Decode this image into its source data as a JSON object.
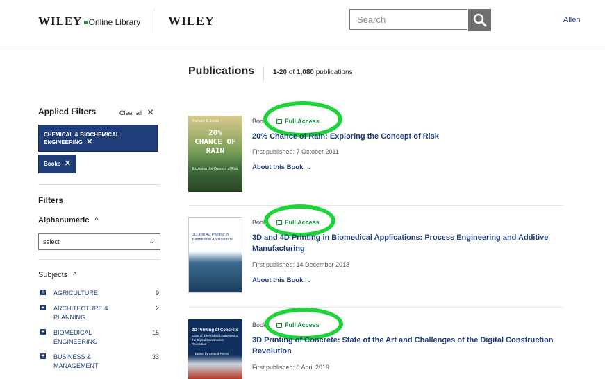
{
  "header": {
    "logo_main": "WILEY",
    "logo_sub": "Online Library",
    "logo_brand": "WILEY",
    "search_placeholder": "Search",
    "user": "Allen"
  },
  "results": {
    "title": "Publications",
    "range": "1-20",
    "of": "of",
    "total": "1,080",
    "unit": "publications"
  },
  "sidebar": {
    "applied_title": "Applied Filters",
    "clear_all": "Clear all",
    "applied": [
      "CHEMICAL & BIOCHEMICAL ENGINEERING",
      "Books"
    ],
    "filters_title": "Filters",
    "alphanumeric_label": "Alphanumeric",
    "select_value": "select",
    "subjects_label": "Subjects",
    "subjects": [
      {
        "label": "AGRICULTURE",
        "count": "9"
      },
      {
        "label": "ARCHITECTURE & PLANNING",
        "count": "2"
      },
      {
        "label": "BIOMEDICAL ENGINEERING",
        "count": "15"
      },
      {
        "label": "BUSINESS & MANAGEMENT",
        "count": "33"
      }
    ]
  },
  "items": [
    {
      "type": "Book",
      "access": "Full Access",
      "title": "20% Chance of Rain: Exploring the Concept of Risk",
      "published": "First published: 7 October 2011",
      "about": "About this Book",
      "cover_author": "Richard B. Jones",
      "cover_title": "20% CHANCE OF RAIN",
      "cover_sub": "Exploring the Concept of Risk"
    },
    {
      "type": "Book",
      "access": "Full Access",
      "title": "3D and 4D Printing in Biomedical Applications: Process Engineering and Additive Manufacturing",
      "published": "First published: 14 December 2018",
      "about": "About this Book",
      "cover_title": "3D and 4D Printing in Biomedical Applications"
    },
    {
      "type": "Book",
      "access": "Full Access",
      "title": "3D Printing of Concrete: State of the Art and Challenges of the Digital Construction Revolution",
      "published": "First published: 8 April 2019",
      "cover_title": "3D Printing of Concrete",
      "cover_sub": "State of the Art and Challenges of the Digital Construction Revolution",
      "cover_author": "Edited by Arnaud Perrot"
    }
  ],
  "colors": {
    "brand_navy": "#1e3d79",
    "access_green": "#138f3a",
    "annotation_ring": "#1fd43a"
  }
}
